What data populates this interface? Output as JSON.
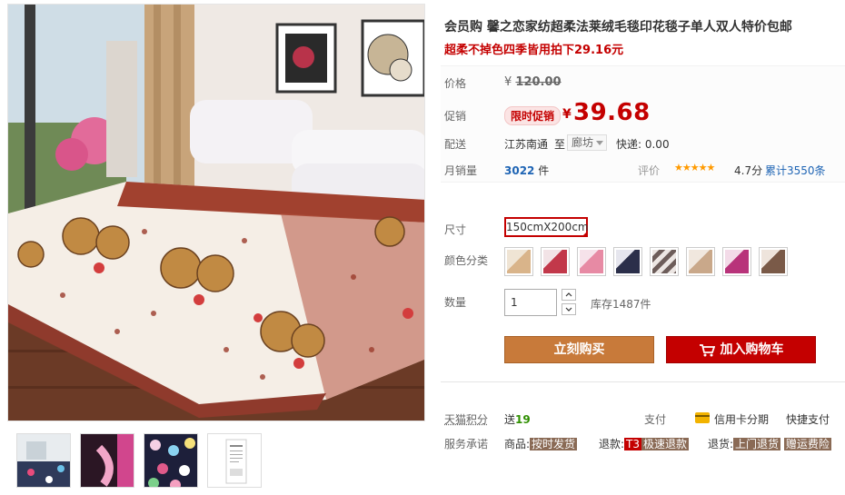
{
  "product": {
    "title": "会员购 馨之恋家纺超柔法莱绒毛毯印花毯子单人双人特价包邮",
    "subtitle": "超柔不掉色四季皆用拍下29.16元"
  },
  "price": {
    "label": "价格",
    "currency": "¥",
    "original": "120.00"
  },
  "promo": {
    "label": "促销",
    "tag": "限时促销",
    "currency": "¥",
    "price": "39.68"
  },
  "shipping": {
    "label": "配送",
    "from": "江苏南通",
    "to_word": "至",
    "destination": "廊坊",
    "express": "快递: 0.00"
  },
  "sales": {
    "label": "月销量",
    "count": "3022",
    "unit": "件",
    "rating_label": "评价",
    "stars": "★★★★★",
    "score": "4.7分",
    "total_reviews": "累计3550条"
  },
  "size": {
    "label": "尺寸",
    "option": "150cmX200cm"
  },
  "color": {
    "label": "颜色分类",
    "swatches": [
      {
        "icon": "blanket-beige-swatch",
        "color": "#d9b48a"
      },
      {
        "icon": "blanket-red-swatch",
        "color": "#c2384a"
      },
      {
        "icon": "blanket-pink-swatch",
        "color": "#e78aa4"
      },
      {
        "icon": "blanket-navy-swatch",
        "color": "#2b2f4a"
      },
      {
        "icon": "blanket-stripe-swatch",
        "color": "#6d5d5a"
      },
      {
        "icon": "blanket-cream-swatch",
        "color": "#c9a88a"
      },
      {
        "icon": "blanket-magenta-swatch",
        "color": "#b8337a"
      },
      {
        "icon": "blanket-brown-swatch",
        "color": "#7a5a48"
      }
    ]
  },
  "quantity": {
    "label": "数量",
    "value": "1",
    "stock": "库存1487件"
  },
  "actions": {
    "buy_now": "立刻购买",
    "add_to_cart": "加入购物车"
  },
  "services": {
    "points_label": "天猫积分",
    "points_prefix": "送",
    "points_value": "19",
    "pay_label": "支付",
    "credit": "信用卡分期",
    "quick_pay": "快捷支付",
    "promise_label": "服务承诺",
    "goods_prefix": "商品:",
    "goods_badge": "按时发货",
    "refund_prefix": "退款:",
    "refund_t3": "T3",
    "refund_badge": "极速退款",
    "return_prefix": "退货:",
    "return_badge": "上门退货",
    "return_badge2": "赠运费险"
  },
  "colors": {
    "accent": "#c40000",
    "buy_button": "#c87a3a",
    "link": "#1e64b4"
  }
}
